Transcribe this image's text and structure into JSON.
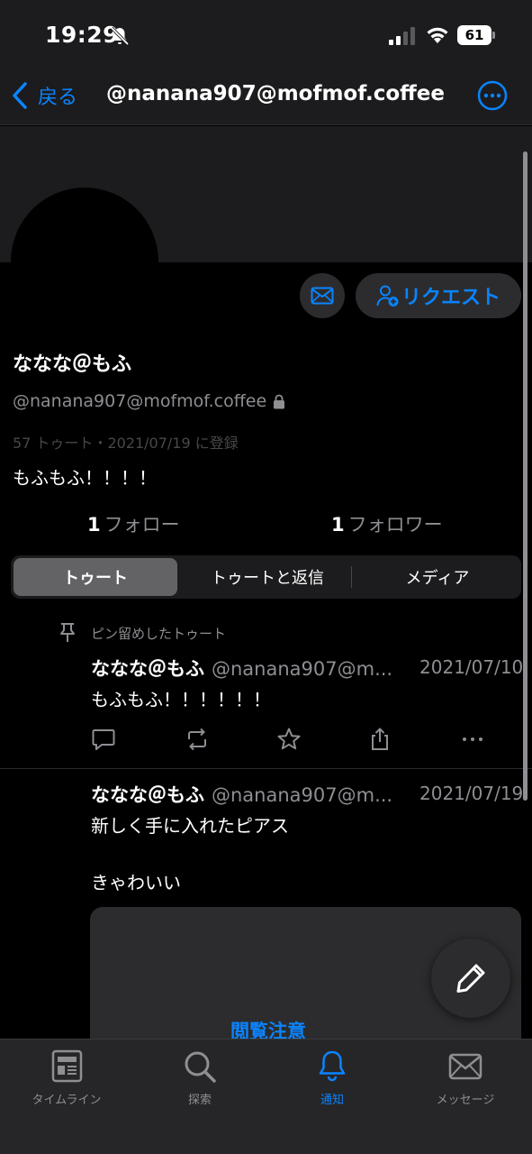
{
  "status": {
    "time": "19:29",
    "battery": "61"
  },
  "nav": {
    "back_label": "戻る",
    "title": "@nanana907@mofmof.coffee"
  },
  "profile": {
    "request_label": "リクエスト",
    "display_name": "ななな＠もふ",
    "handle": "@nanana907@mofmof.coffee",
    "meta": "57 トゥート・2021/07/19 に登録",
    "bio": "もふもふ！！！！",
    "following_count": "1",
    "following_label": "フォロー",
    "followers_count": "1",
    "followers_label": "フォロワー"
  },
  "tabs_segment": [
    "トゥート",
    "トゥートと返信",
    "メディア"
  ],
  "pinned_label": "ピン留めしたトゥート",
  "posts": [
    {
      "name": "ななな＠もふ",
      "handle": "@nanana907@m...",
      "date": "2021/07/10",
      "text": "もふもふ！！！！！！"
    },
    {
      "name": "ななな＠もふ",
      "handle": "@nanana907@m...",
      "date": "2021/07/19",
      "text_line1": "新しく手に入れたピアス",
      "text_line2": "きゃわいい",
      "media_warning": "閲覧注意"
    }
  ],
  "tabbar": [
    "タイムライン",
    "探索",
    "通知",
    "メッセージ"
  ],
  "colors": {
    "accent": "#0a84ff",
    "background": "#000000",
    "surface": "#1c1c1e"
  }
}
